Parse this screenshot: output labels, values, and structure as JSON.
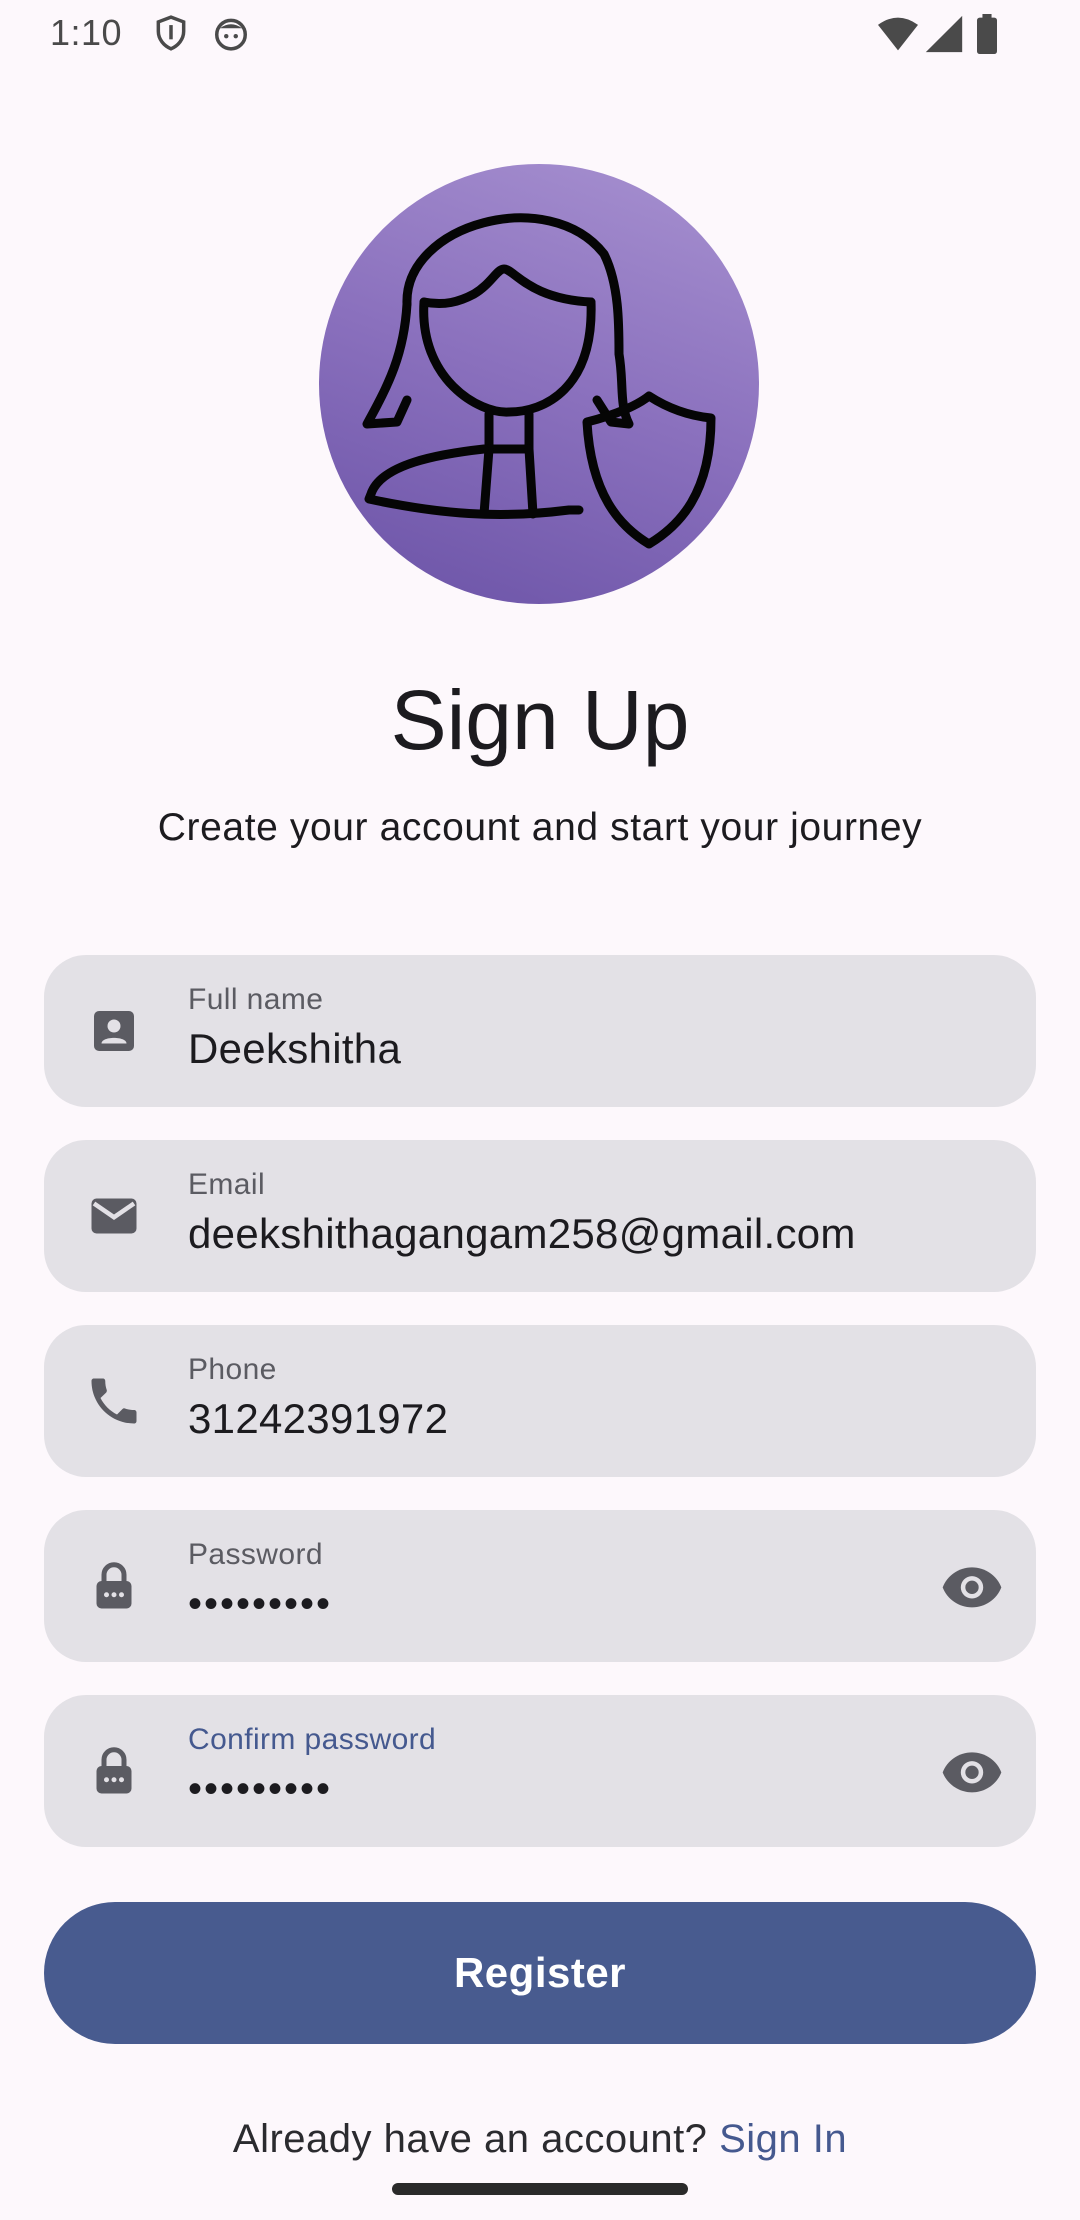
{
  "status_bar": {
    "time": "1:10"
  },
  "header": {
    "title": "Sign Up",
    "subtitle": "Create your account and start your journey"
  },
  "form": {
    "full_name": {
      "label": "Full name",
      "value": "Deekshitha",
      "icon": "contact-card-icon"
    },
    "email": {
      "label": "Email",
      "value": "deekshithagangam258@gmail.com",
      "icon": "envelope-icon"
    },
    "phone": {
      "label": "Phone",
      "value": "31242391972",
      "icon": "phone-icon"
    },
    "password": {
      "label": "Password",
      "value": "•••••••••",
      "icon": "lock-icon",
      "toggle_icon": "eye-icon"
    },
    "confirm_password": {
      "label": "Confirm password",
      "value": "•••••••••",
      "icon": "lock-icon",
      "toggle_icon": "eye-icon"
    }
  },
  "actions": {
    "register_label": "Register",
    "signin_prompt": "Already have an account?",
    "signin_link": "Sign In"
  },
  "colors": {
    "background": "#fdf8fc",
    "field_background": "#e3e1e6",
    "primary": "#485b8f",
    "avatar_gradient_start": "#a892d1",
    "avatar_gradient_end": "#6a52a6"
  }
}
